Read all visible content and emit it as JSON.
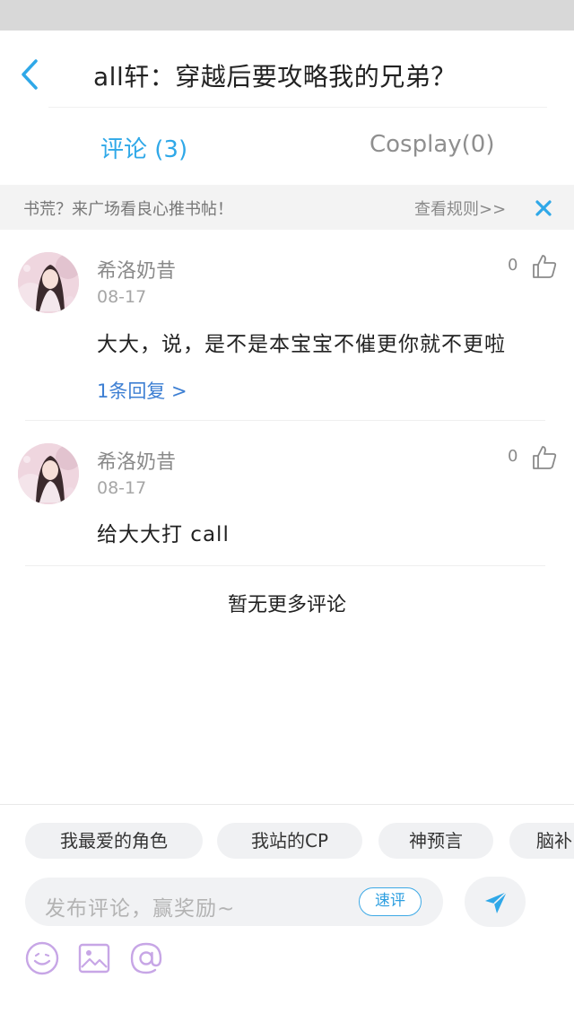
{
  "nav": {
    "title": "all轩：穿越后要攻略我的兄弟？",
    "back_icon": "chevron-left-icon"
  },
  "tabs": {
    "comments": "评论 (3)",
    "cosplay": "Cosplay(0)"
  },
  "notice": {
    "text": "书荒？来广场看良心推书帖！",
    "rules_link": "查看规则>>",
    "close_icon": "close-icon"
  },
  "comments": [
    {
      "user": "希洛奶昔",
      "date": "08-17",
      "text": "大大，说，是不是本宝宝不催更你就不更啦",
      "likes": "0",
      "replies": "1条回复 >"
    },
    {
      "user": "希洛奶昔",
      "date": "08-17",
      "text": "给大大打 call",
      "likes": "0"
    }
  ],
  "no_more": "暂无更多评论",
  "quick_tags": [
    "我最爱的角色",
    "我站的CP",
    "神预言",
    "脑补"
  ],
  "input": {
    "placeholder": "发布评论，赢奖励~",
    "quick_button": "速评"
  },
  "toolbar": {
    "icons": [
      "emoji-icon",
      "image-icon",
      "at-icon"
    ],
    "send_icon": "send-icon"
  },
  "colors": {
    "accent": "#2fa8e8",
    "link": "#3d7fd3",
    "tool_icon": "#c7a6e6"
  }
}
